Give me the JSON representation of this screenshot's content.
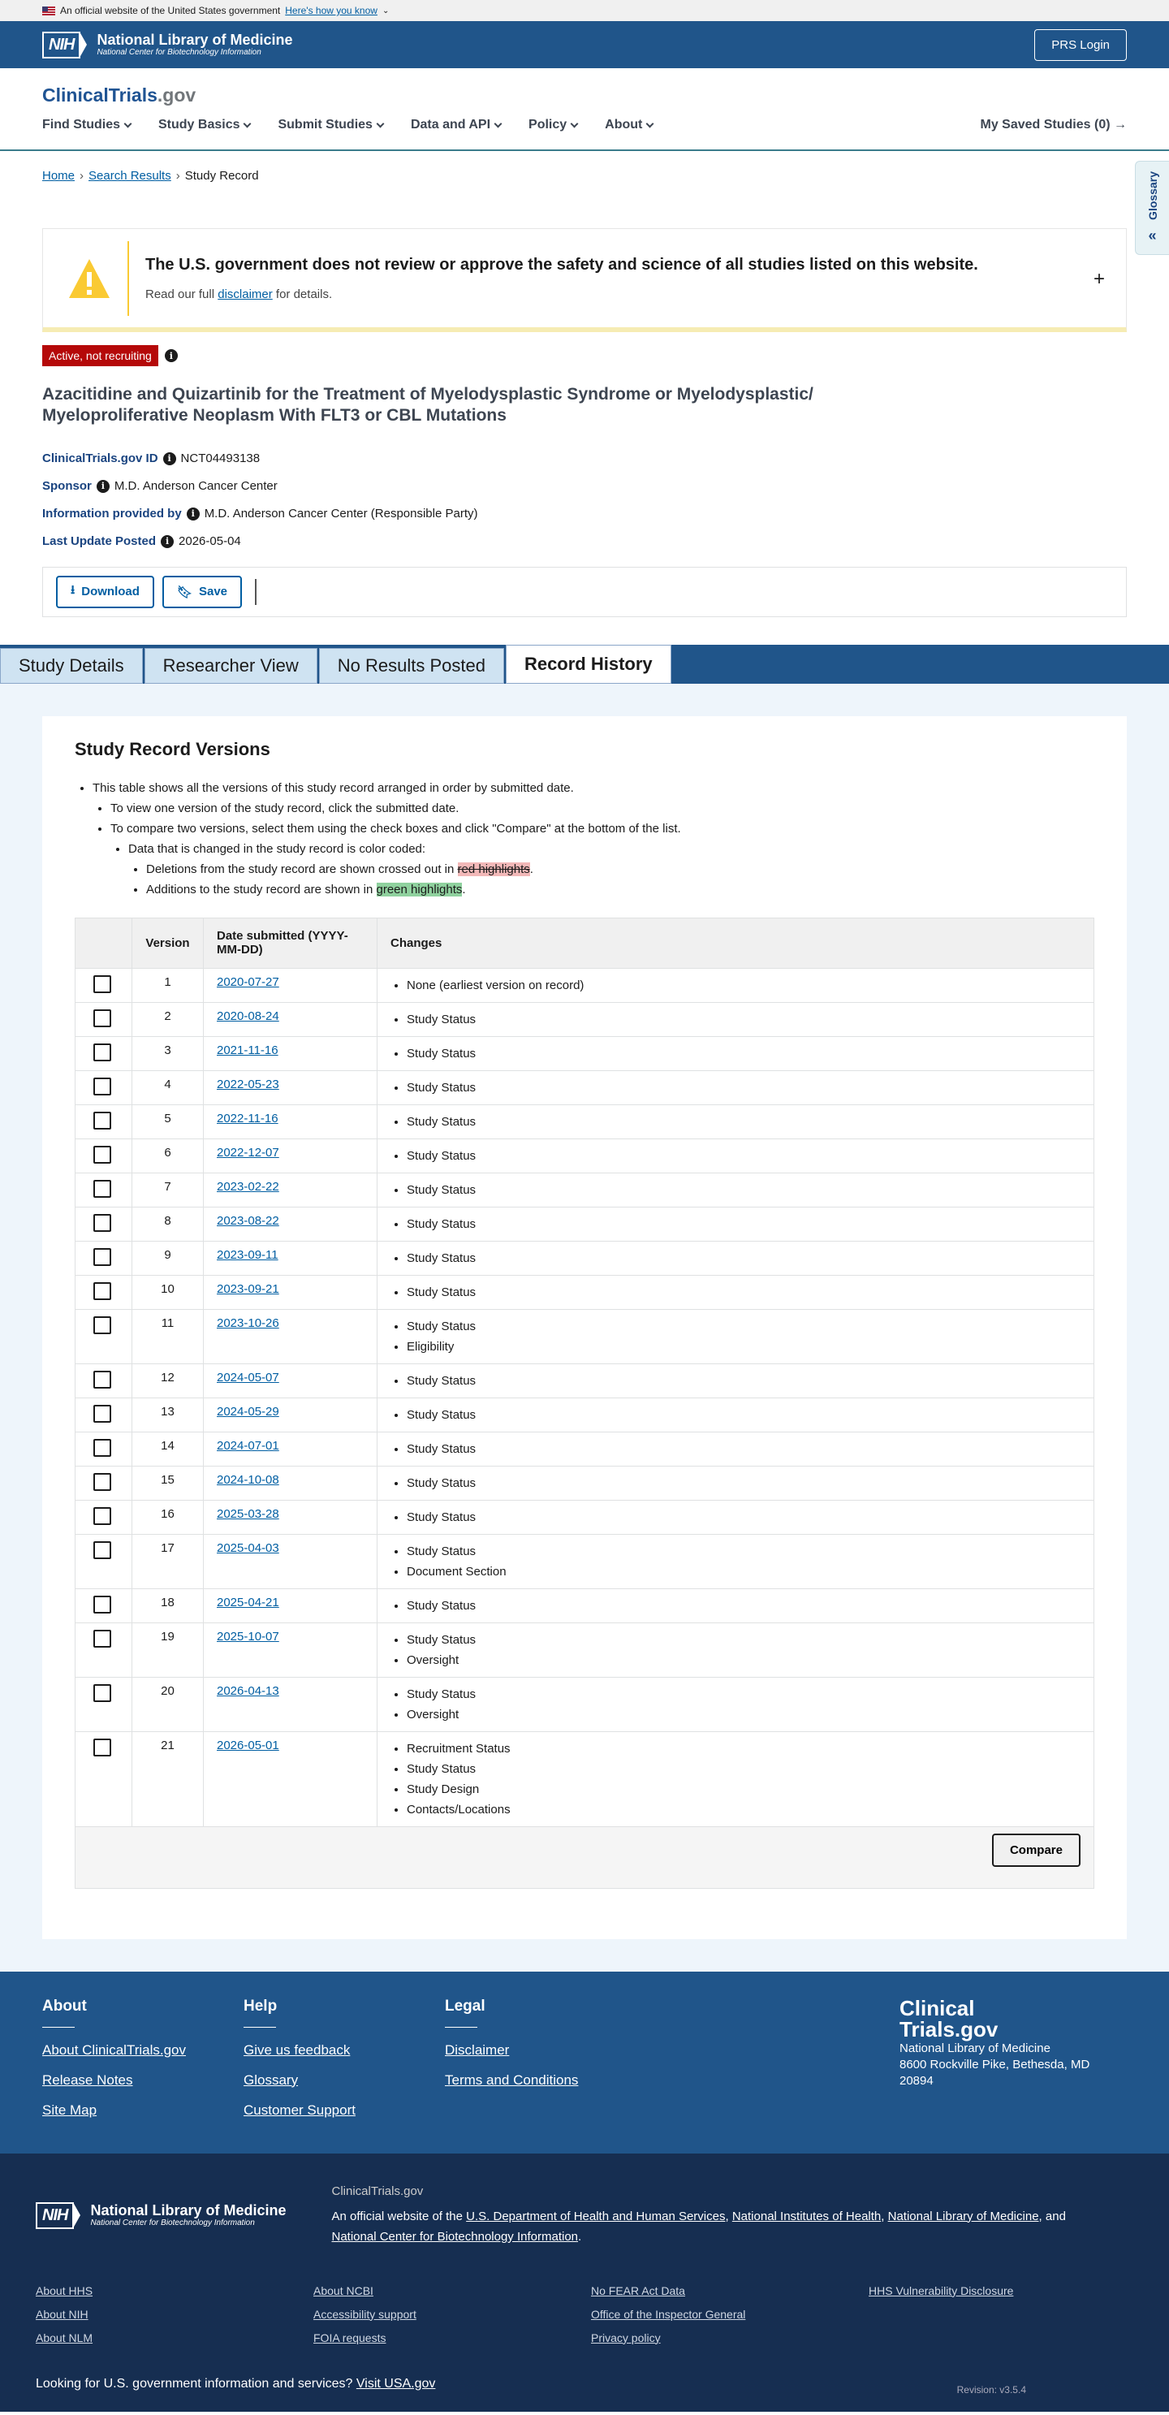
{
  "gov_banner": {
    "text": "An official website of the United States government",
    "link": "Here's how you know"
  },
  "nih": {
    "abbr": "NIH",
    "title": "National Library of Medicine",
    "subtitle": "National Center for Biotechnology Information",
    "prs_login": "PRS Login"
  },
  "brand": {
    "name": "ClinicalTrials",
    "suffix": ".gov"
  },
  "nav": {
    "items": [
      "Find Studies",
      "Study Basics",
      "Submit Studies",
      "Data and API",
      "Policy",
      "About"
    ],
    "saved": "My Saved Studies (0)"
  },
  "breadcrumb": {
    "home": "Home",
    "search": "Search Results",
    "current": "Study Record"
  },
  "glossary": {
    "label": "Glossary"
  },
  "disclaimer": {
    "heading": "The U.S. government does not review or approve the safety and science of all studies listed on this website.",
    "pre": "Read our full",
    "link": "disclaimer",
    "post": "for details."
  },
  "study": {
    "status": "Active, not recruiting",
    "title": "Azacitidine and Quizartinib for the Treatment of Myelodysplastic Syndrome or Myelodysplastic/ Myeloproliferative Neoplasm With FLT3 or CBL Mutations",
    "id_label": "ClinicalTrials.gov ID",
    "id": "NCT04493138",
    "sponsor_label": "Sponsor",
    "sponsor": "M.D. Anderson Cancer Center",
    "provided_label": "Information provided by",
    "provided": "M.D. Anderson Cancer Center (Responsible Party)",
    "update_label": "Last Update Posted",
    "update": "2026-05-04"
  },
  "actions": {
    "download": "Download",
    "save": "Save"
  },
  "tabs": [
    "Study Details",
    "Researcher View",
    "No Results Posted",
    "Record History"
  ],
  "versions": {
    "heading": "Study Record Versions",
    "info1": "This table shows all the versions of this study record arranged in order by submitted date.",
    "info2": "To view one version of the study record, click the submitted date.",
    "info3": "To compare two versions, select them using the check boxes and click \"Compare\" at the bottom of the list.",
    "info4": "Data that is changed in the study record is color coded:",
    "del_pre": "Deletions from the study record are shown crossed out in",
    "del_hl": "red highlights",
    "add_pre": "Additions to the study record are shown in",
    "add_hl": "green highlights",
    "col_version": "Version",
    "col_date": "Date submitted (YYYY-MM-DD)",
    "col_changes": "Changes",
    "compare": "Compare",
    "rows": [
      {
        "v": "1",
        "date": "2020-07-27",
        "changes": [
          "None (earliest version on record)"
        ]
      },
      {
        "v": "2",
        "date": "2020-08-24",
        "changes": [
          "Study Status"
        ]
      },
      {
        "v": "3",
        "date": "2021-11-16",
        "changes": [
          "Study Status"
        ]
      },
      {
        "v": "4",
        "date": "2022-05-23",
        "changes": [
          "Study Status"
        ]
      },
      {
        "v": "5",
        "date": "2022-11-16",
        "changes": [
          "Study Status"
        ]
      },
      {
        "v": "6",
        "date": "2022-12-07",
        "changes": [
          "Study Status"
        ]
      },
      {
        "v": "7",
        "date": "2023-02-22",
        "changes": [
          "Study Status"
        ]
      },
      {
        "v": "8",
        "date": "2023-08-22",
        "changes": [
          "Study Status"
        ]
      },
      {
        "v": "9",
        "date": "2023-09-11",
        "changes": [
          "Study Status"
        ]
      },
      {
        "v": "10",
        "date": "2023-09-21",
        "changes": [
          "Study Status"
        ]
      },
      {
        "v": "11",
        "date": "2023-10-26",
        "changes": [
          "Study Status",
          "Eligibility"
        ]
      },
      {
        "v": "12",
        "date": "2024-05-07",
        "changes": [
          "Study Status"
        ]
      },
      {
        "v": "13",
        "date": "2024-05-29",
        "changes": [
          "Study Status"
        ]
      },
      {
        "v": "14",
        "date": "2024-07-01",
        "changes": [
          "Study Status"
        ]
      },
      {
        "v": "15",
        "date": "2024-10-08",
        "changes": [
          "Study Status"
        ]
      },
      {
        "v": "16",
        "date": "2025-03-28",
        "changes": [
          "Study Status"
        ]
      },
      {
        "v": "17",
        "date": "2025-04-03",
        "changes": [
          "Study Status",
          "Document Section"
        ]
      },
      {
        "v": "18",
        "date": "2025-04-21",
        "changes": [
          "Study Status"
        ]
      },
      {
        "v": "19",
        "date": "2025-10-07",
        "changes": [
          "Study Status",
          "Oversight"
        ]
      },
      {
        "v": "20",
        "date": "2026-04-13",
        "changes": [
          "Study Status",
          "Oversight"
        ]
      },
      {
        "v": "21",
        "date": "2026-05-01",
        "changes": [
          "Recruitment Status",
          "Study Status",
          "Study Design",
          "Contacts/Locations"
        ]
      }
    ]
  },
  "footer": {
    "about": {
      "title": "About",
      "links": [
        "About ClinicalTrials.gov",
        "Release Notes",
        "Site Map"
      ]
    },
    "help": {
      "title": "Help",
      "links": [
        "Give us feedback",
        "Glossary",
        "Customer Support"
      ]
    },
    "legal": {
      "title": "Legal",
      "links": [
        "Disclaimer",
        "Terms and Conditions"
      ]
    },
    "contact": {
      "line1": "Clinical",
      "line2": "Trials.gov",
      "org": "National Library of Medicine",
      "addr1": "8600 Rockville Pike, Bethesda, MD",
      "addr2": "20894"
    }
  },
  "nlm_footer": {
    "site": "ClinicalTrials.gov",
    "pre": "An official website of the",
    "hhs": "U.S. Department of Health and Human Services",
    "nih": "National Institutes of Health",
    "nlm": "National Library of Medicine",
    "and": "and",
    "ncbi": "National Center for Biotechnology Information",
    "links": [
      "About HHS",
      "About NCBI",
      "No FEAR Act Data",
      "HHS Vulnerability Disclosure",
      "About NIH",
      "Accessibility support",
      "Office of the Inspector General",
      "",
      "About NLM",
      "FOIA requests",
      "Privacy policy",
      ""
    ],
    "usagov_pre": "Looking for U.S. government information and services?",
    "usagov_link": "Visit USA.gov",
    "revision": "Revision: v3.5.4"
  }
}
